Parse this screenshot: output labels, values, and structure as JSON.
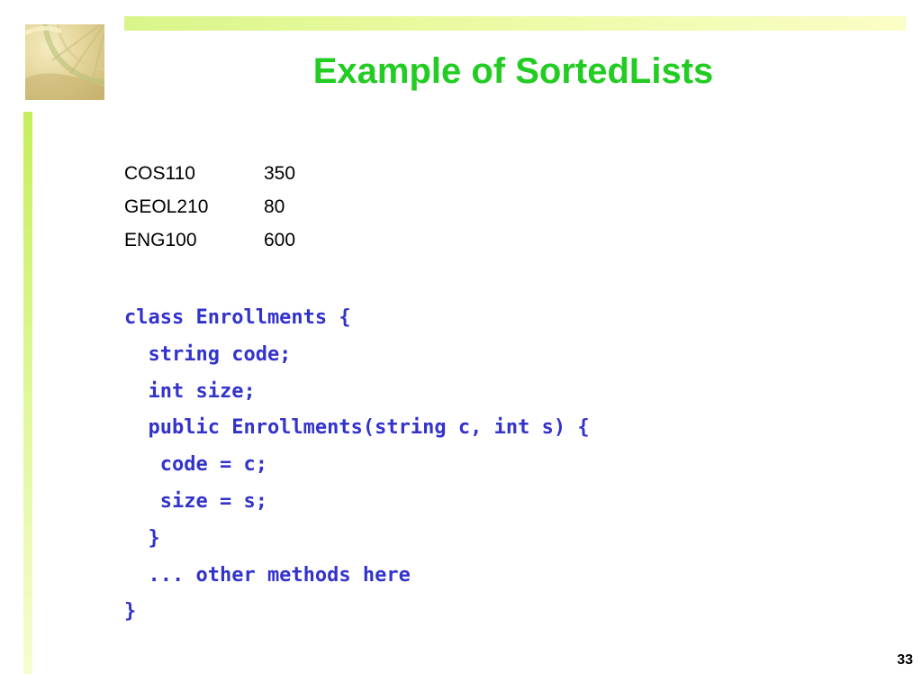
{
  "slide": {
    "title": "Example of SortedLists",
    "page_number": "33"
  },
  "courses": [
    {
      "code": "COS110",
      "size": "350"
    },
    {
      "code": "GEOL210",
      "size": "80"
    },
    {
      "code": "ENG100",
      "size": "600"
    }
  ],
  "code_lines": [
    "class Enrollments {",
    "  string code;",
    "  int size;",
    "  public Enrollments(string c, int s) {",
    "   code = c;",
    "   size = s;",
    "  }",
    "  ... other methods here",
    "}"
  ],
  "colors": {
    "title": "#22cc22",
    "code": "#3333cc",
    "accent_bar": "#c4ef5a"
  }
}
